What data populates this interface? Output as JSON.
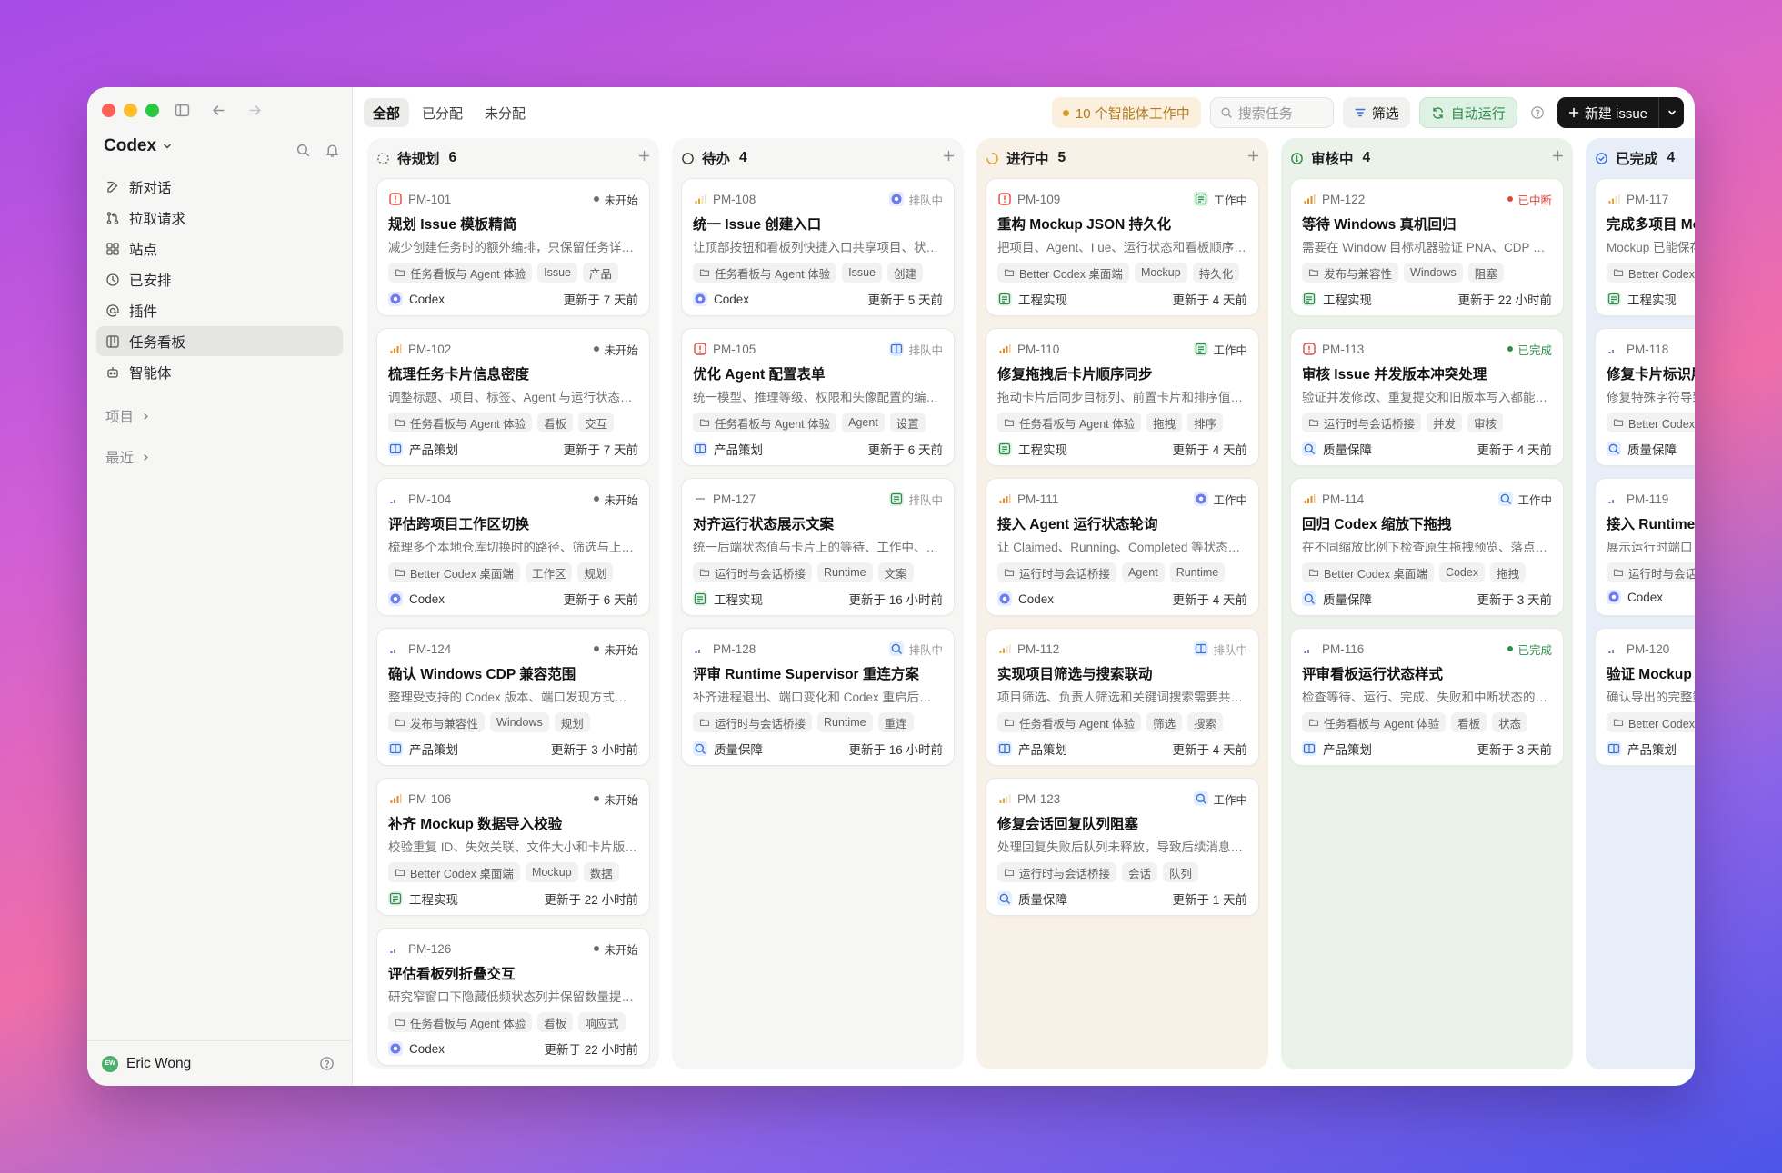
{
  "sidebar": {
    "brand": "Codex",
    "nav": [
      {
        "label": "新对话",
        "icon": "edit-icon"
      },
      {
        "label": "拉取请求",
        "icon": "pull-request-icon"
      },
      {
        "label": "站点",
        "icon": "grid-icon"
      },
      {
        "label": "已安排",
        "icon": "clock-icon"
      },
      {
        "label": "插件",
        "icon": "at-icon"
      },
      {
        "label": "任务看板",
        "icon": "board-icon",
        "active": true
      },
      {
        "label": "智能体",
        "icon": "robot-icon"
      }
    ],
    "sections": [
      "项目",
      "最近"
    ],
    "user": {
      "initials": "EW",
      "name": "Eric Wong"
    }
  },
  "topbar": {
    "tabs": [
      {
        "label": "全部",
        "active": true
      },
      {
        "label": "已分配"
      },
      {
        "label": "未分配"
      }
    ],
    "agents_working": "10 个智能体工作中",
    "search_placeholder": "搜索任务",
    "filter": "筛选",
    "autorun": "自动运行",
    "new_issue": "新建 issue"
  },
  "colors": {
    "accent": "#161616",
    "warning": "#d49a2b",
    "success": "#2e8b4a",
    "danger": "#e0463c",
    "info": "#3a6fd8"
  },
  "columns": [
    {
      "title": "待规划",
      "count": "6",
      "icon": "dashed-circle-icon",
      "bg": "#f6f6f5",
      "cards": [
        {
          "id": "PM-101",
          "priority": "urgent",
          "status": "未开始",
          "status_kind": "dot",
          "title": "规划 Issue 模板精简",
          "desc": "减少创建任务时的额外编排，只保留任务详情与必要字段",
          "tags": [
            "任务看板与 Agent 体验",
            "Issue",
            "产品"
          ],
          "assignee": "Codex",
          "assignee_kind": "codex",
          "updated": "更新于 7 天前"
        },
        {
          "id": "PM-102",
          "priority": "high",
          "status": "未开始",
          "status_kind": "dot",
          "title": "梳理任务卡片信息密度",
          "desc": "调整标题、项目、标签、Agent 与运行状态的层级关系",
          "tags": [
            "任务看板与 Agent 体验",
            "看板",
            "交互"
          ],
          "assignee": "产品策划",
          "assignee_kind": "product",
          "updated": "更新于 7 天前"
        },
        {
          "id": "PM-104",
          "priority": "low",
          "status": "未开始",
          "status_kind": "dot",
          "title": "评估跨项目工作区切换",
          "desc": "梳理多个本地仓库切换时的路径、筛选与上下文保持",
          "tags": [
            "Better Codex 桌面端",
            "工作区",
            "规划"
          ],
          "assignee": "Codex",
          "assignee_kind": "codex",
          "updated": "更新于 6 天前"
        },
        {
          "id": "PM-124",
          "priority": "low",
          "status": "未开始",
          "status_kind": "dot",
          "title": "确认 Windows CDP 兼容范围",
          "desc": "整理受支持的 Codex 版本、端口发现方式和限制说明",
          "tags": [
            "发布与兼容性",
            "Windows",
            "规划"
          ],
          "assignee": "产品策划",
          "assignee_kind": "product",
          "updated": "更新于 3 小时前"
        },
        {
          "id": "PM-106",
          "priority": "high",
          "status": "未开始",
          "status_kind": "dot",
          "title": "补齐 Mockup 数据导入校验",
          "desc": "校验重复 ID、失效关联、文件大小和卡片版本信息",
          "tags": [
            "Better Codex 桌面端",
            "Mockup",
            "数据"
          ],
          "assignee": "工程实现",
          "assignee_kind": "eng",
          "updated": "更新于 22 小时前"
        },
        {
          "id": "PM-126",
          "priority": "low",
          "status": "未开始",
          "status_kind": "dot",
          "title": "评估看板列折叠交互",
          "desc": "研究窄窗口下隐藏低频状态列并保留数量提示的方案",
          "tags": [
            "任务看板与 Agent 体验",
            "看板",
            "响应式"
          ],
          "assignee": "Codex",
          "assignee_kind": "codex",
          "updated": "更新于 22 小时前"
        }
      ]
    },
    {
      "title": "待办",
      "count": "4",
      "icon": "circle-icon",
      "bg": "#f6f6f5",
      "cards": [
        {
          "id": "PM-108",
          "priority": "medium",
          "status": "排队中",
          "status_kind": "codex",
          "title": "统一 Issue 创建入口",
          "desc": "让顶部按钮和看板列快捷入口共享项目、状态与默认值",
          "tags": [
            "任务看板与 Agent 体验",
            "Issue",
            "创建"
          ],
          "assignee": "Codex",
          "assignee_kind": "codex",
          "updated": "更新于 5 天前"
        },
        {
          "id": "PM-105",
          "priority": "urgent",
          "status": "排队中",
          "status_kind": "product",
          "title": "优化 Agent 配置表单",
          "desc": "统一模型、推理等级、权限和头像配置的编辑体验",
          "tags": [
            "任务看板与 Agent 体验",
            "Agent",
            "设置"
          ],
          "assignee": "产品策划",
          "assignee_kind": "product",
          "updated": "更新于 6 天前"
        },
        {
          "id": "PM-127",
          "priority": "none",
          "status": "排队中",
          "status_kind": "eng",
          "title": "对齐运行状态展示文案",
          "desc": "统一后端状态值与卡片上的等待、工作中、完成文案",
          "tags": [
            "运行时与会话桥接",
            "Runtime",
            "文案"
          ],
          "assignee": "工程实现",
          "assignee_kind": "eng",
          "updated": "更新于 16 小时前"
        },
        {
          "id": "PM-128",
          "priority": "low",
          "status": "排队中",
          "status_kind": "qa",
          "title": "评审 Runtime Supervisor 重连方案",
          "desc": "补齐进程退出、端口变化和 Codex 重启后的恢复路径",
          "tags": [
            "运行时与会话桥接",
            "Runtime",
            "重连"
          ],
          "assignee": "质量保障",
          "assignee_kind": "qa",
          "updated": "更新于 16 小时前"
        }
      ]
    },
    {
      "title": "进行中",
      "count": "5",
      "icon": "progress-icon",
      "bg": "#f8f1e8",
      "cards": [
        {
          "id": "PM-109",
          "priority": "urgent",
          "status": "工作中",
          "status_kind": "eng",
          "title": "重构 Mockup JSON 持久化",
          "desc": "把项目、Agent、I ue、运行状态和看板顺序写入文件",
          "tags": [
            "Better Codex 桌面端",
            "Mockup",
            "持久化"
          ],
          "assignee": "工程实现",
          "assignee_kind": "eng",
          "updated": "更新于 4 天前"
        },
        {
          "id": "PM-110",
          "priority": "high",
          "status": "工作中",
          "status_kind": "eng",
          "title": "修复拖拽后卡片顺序同步",
          "desc": "拖动卡片后同步目标列、前置卡片和排序值，避免回跳",
          "tags": [
            "任务看板与 Agent 体验",
            "拖拽",
            "排序"
          ],
          "assignee": "工程实现",
          "assignee_kind": "eng",
          "updated": "更新于 4 天前"
        },
        {
          "id": "PM-111",
          "priority": "high",
          "status": "工作中",
          "status_kind": "codex",
          "title": "接入 Agent 运行状态轮询",
          "desc": "让 Claimed、Running、Completed 等状态实时反映到卡片",
          "tags": [
            "运行时与会话桥接",
            "Agent",
            "Runtime"
          ],
          "assignee": "Codex",
          "assignee_kind": "codex",
          "updated": "更新于 4 天前"
        },
        {
          "id": "PM-112",
          "priority": "medium",
          "status": "排队中",
          "status_kind": "product",
          "title": "实现项目筛选与搜索联动",
          "desc": "项目筛选、负责人筛选和关键词搜索需要共同作用",
          "tags": [
            "任务看板与 Agent 体验",
            "筛选",
            "搜索"
          ],
          "assignee": "产品策划",
          "assignee_kind": "product",
          "updated": "更新于 4 天前"
        },
        {
          "id": "PM-123",
          "priority": "medium",
          "status": "工作中",
          "status_kind": "qa",
          "title": "修复会话回复队列阻塞",
          "desc": "处理回复失败后队列未释放，导致后续消息无法发送",
          "tags": [
            "运行时与会话桥接",
            "会话",
            "队列"
          ],
          "assignee": "质量保障",
          "assignee_kind": "qa",
          "updated": "更新于 1 天前"
        }
      ]
    },
    {
      "title": "审核中",
      "count": "4",
      "icon": "check-circle-icon",
      "bg": "#eaf2ea",
      "cards": [
        {
          "id": "PM-122",
          "priority": "high",
          "status": "已中断",
          "status_kind": "red",
          "title": "等待 Windows 真机回归",
          "desc": "需要在 Window 目标机器验证 PNA、CDP 端口与启动流程",
          "tags": [
            "发布与兼容性",
            "Windows",
            "阻塞"
          ],
          "assignee": "工程实现",
          "assignee_kind": "eng",
          "updated": "更新于 22 小时前"
        },
        {
          "id": "PM-113",
          "priority": "urgent",
          "status": "已完成",
          "status_kind": "green",
          "title": "审核 Issue 并发版本冲突处理",
          "desc": "验证并发修改、重复提交和旧版本写入都能返回冲突",
          "tags": [
            "运行时与会话桥接",
            "并发",
            "审核"
          ],
          "assignee": "质量保障",
          "assignee_kind": "qa",
          "updated": "更新于 4 天前"
        },
        {
          "id": "PM-114",
          "priority": "high",
          "status": "工作中",
          "status_kind": "qa",
          "title": "回归 Codex 缩放下拖拽",
          "desc": "在不同缩放比例下检查原生拖拽预览、落点和滚动",
          "tags": [
            "Better Codex 桌面端",
            "Codex",
            "拖拽"
          ],
          "assignee": "质量保障",
          "assignee_kind": "qa",
          "updated": "更新于 3 天前"
        },
        {
          "id": "PM-116",
          "priority": "low",
          "status": "已完成",
          "status_kind": "green",
          "title": "评审看板运行状态样式",
          "desc": "检查等待、运行、完成、失败和中断状态的颜色与图标",
          "tags": [
            "任务看板与 Agent 体验",
            "看板",
            "状态"
          ],
          "assignee": "产品策划",
          "assignee_kind": "product",
          "updated": "更新于 3 天前"
        }
      ]
    },
    {
      "title": "已完成",
      "count": "4",
      "icon": "done-circle-icon",
      "bg": "#e8eef8",
      "cards": [
        {
          "id": "PM-117",
          "priority": "medium",
          "status": "",
          "status_kind": "none",
          "title": "完成多项目 Mockup",
          "desc": "Mockup 已能保存多个项目",
          "tags": [
            "Better Codex 桌面端"
          ],
          "assignee": "工程实现",
          "assignee_kind": "eng",
          "updated": ""
        },
        {
          "id": "PM-118",
          "priority": "low",
          "status": "",
          "status_kind": "none",
          "title": "修复卡片标识展示",
          "desc": "修复特殊字符导致",
          "tags": [
            "Better Codex 桌面端"
          ],
          "assignee": "质量保障",
          "assignee_kind": "qa",
          "updated": ""
        },
        {
          "id": "PM-119",
          "priority": "low",
          "status": "",
          "status_kind": "none",
          "title": "接入 Runtime 事件",
          "desc": "展示运行时端口",
          "tags": [
            "运行时与会话桥接"
          ],
          "assignee": "Codex",
          "assignee_kind": "codex",
          "updated": ""
        },
        {
          "id": "PM-120",
          "priority": "low",
          "status": "",
          "status_kind": "none",
          "title": "验证 Mockup 导出",
          "desc": "确认导出的完整数据",
          "tags": [
            "Better Codex 桌面端"
          ],
          "assignee": "产品策划",
          "assignee_kind": "product",
          "updated": ""
        }
      ]
    }
  ]
}
